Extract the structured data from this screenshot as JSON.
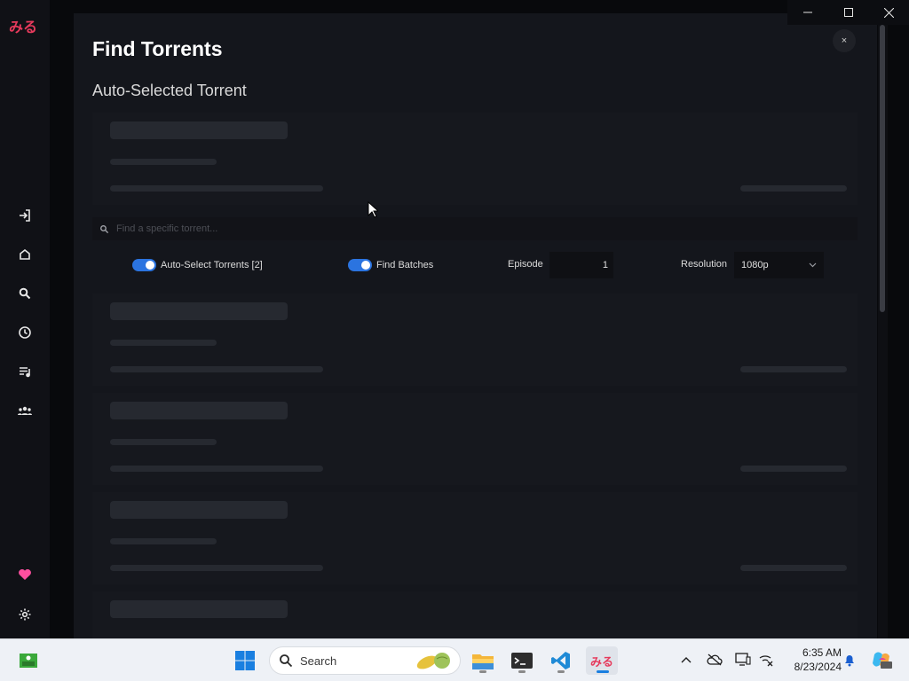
{
  "app": {
    "logo_text": "みる"
  },
  "sidebar": {
    "items": [
      {
        "name": "login",
        "icon": "login-icon"
      },
      {
        "name": "home",
        "icon": "home-icon"
      },
      {
        "name": "search",
        "icon": "search-icon"
      },
      {
        "name": "schedule",
        "icon": "clock-icon"
      },
      {
        "name": "watchlist",
        "icon": "playlist-icon"
      },
      {
        "name": "watch-together",
        "icon": "group-icon"
      }
    ],
    "bottom_items": [
      {
        "name": "donate",
        "icon": "heart-icon"
      },
      {
        "name": "settings",
        "icon": "gear-icon"
      }
    ]
  },
  "modal": {
    "title": "Find Torrents",
    "subtitle": "Auto-Selected Torrent",
    "close_label": "×",
    "search": {
      "placeholder": "Find a specific torrent...",
      "value": ""
    },
    "options": {
      "auto_select_label": "Auto-Select Torrents [2]",
      "auto_select_on": true,
      "find_batches_label": "Find Batches",
      "find_batches_on": true,
      "episode_label": "Episode",
      "episode_value": "1",
      "resolution_label": "Resolution",
      "resolution_value": "1080p"
    }
  },
  "taskbar": {
    "search_label": "Search",
    "time": "6:35 AM",
    "date": "8/23/2024"
  },
  "colors": {
    "accent": "#2b74e0",
    "brand": "#e63a5c",
    "heart": "#ff4fa0",
    "background": "#14161c"
  }
}
